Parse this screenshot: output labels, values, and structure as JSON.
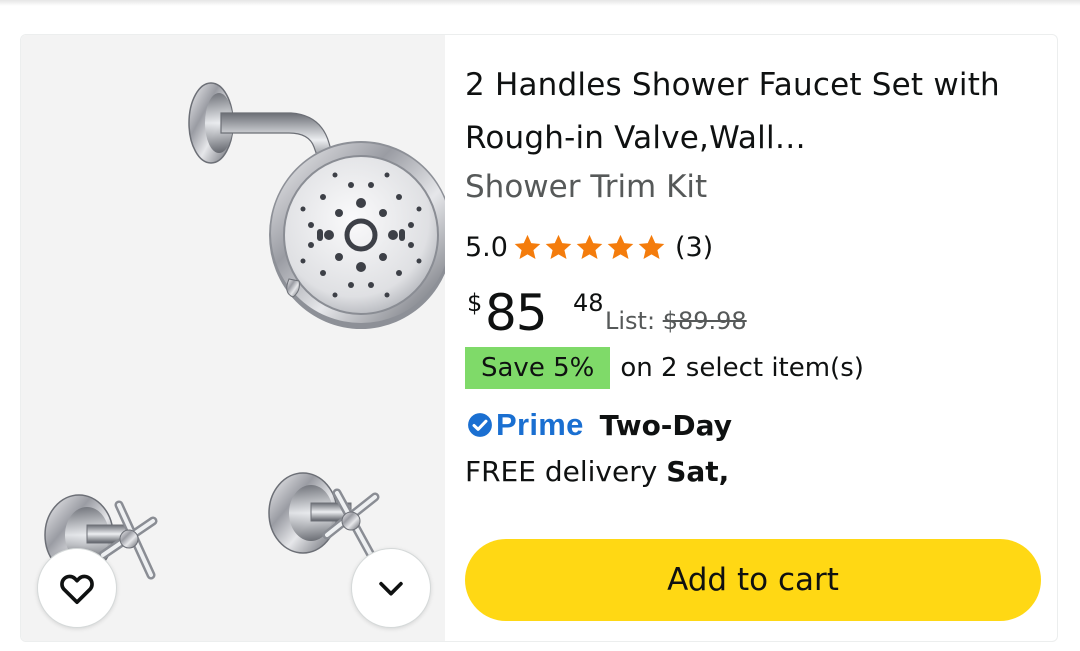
{
  "product": {
    "title_line1": "2 Handles Shower Faucet Set with",
    "title_line2": "Rough-in Valve,Wall…",
    "subtitle": "Shower Trim Kit",
    "image_alt": "Chrome shower head with arm and two cross handles",
    "rating": {
      "value": "5.0",
      "stars": 5,
      "count": "(3)",
      "star_color": "#f47c0c"
    },
    "price": {
      "symbol": "$",
      "whole": "85",
      "fraction": "48",
      "list_label": "List:",
      "list_price": "$89.98"
    },
    "promo": {
      "badge": "Save 5%",
      "text": "on 2 select item(s)",
      "badge_color": "#7fda69"
    },
    "shipping": {
      "prime_label": "Prime",
      "prime_speed": "Two-Day",
      "prime_color": "#1a6fd1",
      "delivery_prefix": "FREE delivery",
      "delivery_day": "Sat,"
    },
    "actions": {
      "wishlist_icon": "heart-icon",
      "more_icon": "chevron-down-icon",
      "add_to_cart": "Add to cart",
      "cart_color": "#ffd814"
    }
  }
}
